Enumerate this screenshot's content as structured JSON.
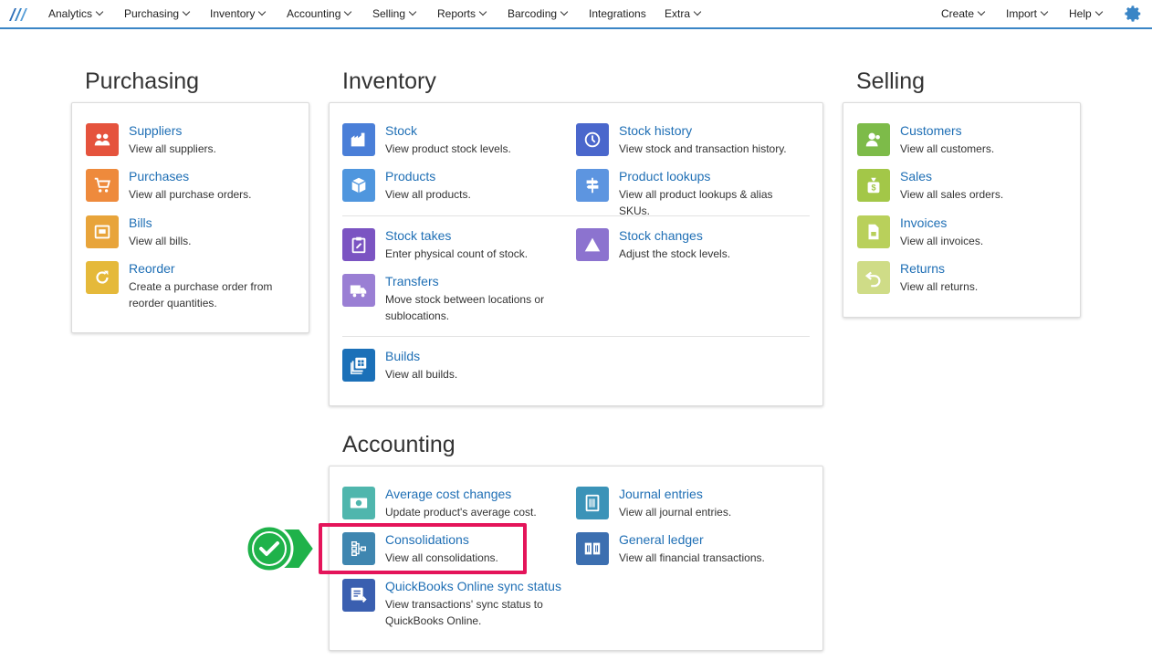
{
  "nav": {
    "left": [
      {
        "label": "Analytics"
      },
      {
        "label": "Purchasing"
      },
      {
        "label": "Inventory"
      },
      {
        "label": "Accounting"
      },
      {
        "label": "Selling"
      },
      {
        "label": "Reports"
      },
      {
        "label": "Barcoding"
      },
      {
        "label": "Integrations"
      },
      {
        "label": "Extra"
      }
    ],
    "right": [
      {
        "label": "Create"
      },
      {
        "label": "Import"
      },
      {
        "label": "Help"
      }
    ],
    "settings_icon": "gear-icon",
    "accent_color": "#3a85c6"
  },
  "purchasing": {
    "title": "Purchasing",
    "items": [
      {
        "title": "Suppliers",
        "desc": "View all suppliers.",
        "icon": "suppliers-icon",
        "color": "#e5533d"
      },
      {
        "title": "Purchases",
        "desc": "View all purchase orders.",
        "icon": "cart-icon",
        "color": "#ee8a3c"
      },
      {
        "title": "Bills",
        "desc": "View all bills.",
        "icon": "bill-icon",
        "color": "#e8a43a"
      },
      {
        "title": "Reorder",
        "desc": "Create a purchase order from reorder quantities.",
        "icon": "reorder-icon",
        "color": "#e5b93a"
      }
    ]
  },
  "inventory": {
    "title": "Inventory",
    "items": [
      {
        "title": "Stock",
        "desc": "View product stock levels.",
        "icon": "warehouse-icon",
        "color": "#4a7fd8"
      },
      {
        "title": "Stock history",
        "desc": "View stock and transaction history.",
        "icon": "history-icon",
        "color": "#4a67cc"
      },
      {
        "title": "Products",
        "desc": "View all products.",
        "icon": "box-icon",
        "color": "#4f96de"
      },
      {
        "title": "Product lookups",
        "desc": "View all product lookups & alias SKUs.",
        "icon": "signpost-icon",
        "color": "#5d95e0"
      },
      {
        "title": "Stock takes",
        "desc": "Enter physical count of stock.",
        "icon": "clipboard-icon",
        "color": "#7b54c2"
      },
      {
        "title": "Stock changes",
        "desc": "Adjust the stock levels.",
        "icon": "triangle-icon",
        "color": "#8c73cf"
      },
      {
        "title": "Transfers",
        "desc": "Move stock between locations or sublocations.",
        "icon": "truck-icon",
        "color": "#9a7fd4"
      },
      {
        "title": "Builds",
        "desc": "View all builds.",
        "icon": "builds-icon",
        "color": "#1b70b8"
      }
    ]
  },
  "selling": {
    "title": "Selling",
    "items": [
      {
        "title": "Customers",
        "desc": "View all customers.",
        "icon": "customers-icon",
        "color": "#7dbb49"
      },
      {
        "title": "Sales",
        "desc": "View all sales orders.",
        "icon": "moneybag-icon",
        "color": "#a3c748"
      },
      {
        "title": "Invoices",
        "desc": "View all invoices.",
        "icon": "invoice-icon",
        "color": "#b9d05b"
      },
      {
        "title": "Returns",
        "desc": "View all returns.",
        "icon": "return-icon",
        "color": "#cfdc87"
      }
    ]
  },
  "accounting": {
    "title": "Accounting",
    "items": [
      {
        "title": "Average cost changes",
        "desc": "Update product's average cost.",
        "icon": "money-icon",
        "color": "#4fb6ad"
      },
      {
        "title": "Journal entries",
        "desc": "View all journal entries.",
        "icon": "journal-icon",
        "color": "#3b93b8"
      },
      {
        "title": "Consolidations",
        "desc": "View all consolidations.",
        "icon": "consolidation-icon",
        "color": "#3f86b0"
      },
      {
        "title": "General ledger",
        "desc": "View all financial transactions.",
        "icon": "ledger-icon",
        "color": "#3c6fb0"
      },
      {
        "title": "QuickBooks Online sync status",
        "desc": "View transactions' sync status to QuickBooks Online.",
        "icon": "sync-status-icon",
        "color": "#3a5fb0"
      }
    ]
  },
  "callout": {
    "icon": "checkmark-icon",
    "color": "#1fb24a",
    "highlight_color": "#e4145a"
  }
}
